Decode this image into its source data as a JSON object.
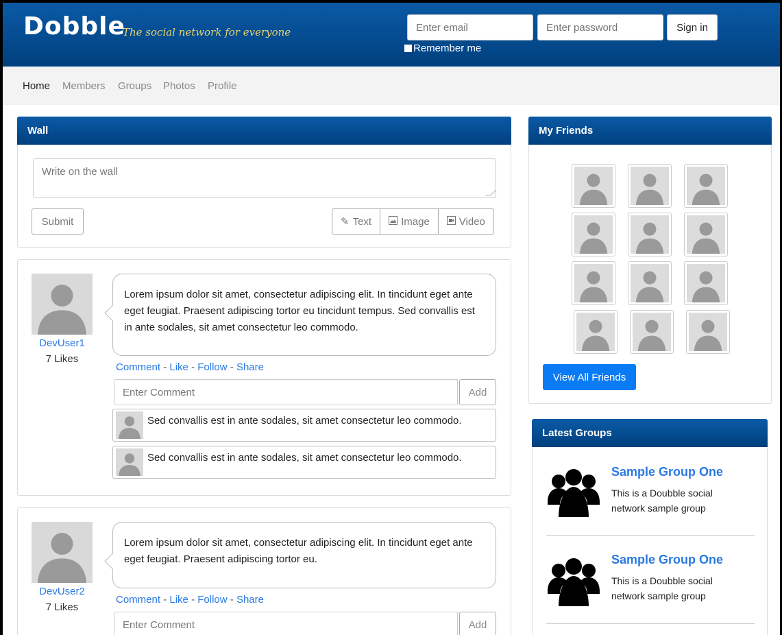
{
  "header": {
    "logo": "Dobble",
    "tagline": "The social network for everyone",
    "email_placeholder": "Enter email",
    "password_placeholder": "Enter password",
    "signin_label": "Sign in",
    "remember_label": "Remember me",
    "colors": {
      "bar": "#0b5aa6",
      "tagline": "#e7d36b"
    }
  },
  "nav": {
    "items": [
      {
        "label": "Home",
        "active": true
      },
      {
        "label": "Members"
      },
      {
        "label": "Groups"
      },
      {
        "label": "Photos"
      },
      {
        "label": "Profile"
      }
    ]
  },
  "wall": {
    "title": "Wall",
    "textarea_placeholder": "Write on the wall",
    "submit_label": "Submit",
    "post_types": [
      {
        "label": "Text",
        "icon": "pencil-icon"
      },
      {
        "label": "Image",
        "icon": "image-icon"
      },
      {
        "label": "Video",
        "icon": "video-icon"
      }
    ]
  },
  "posts": [
    {
      "user": "DevUser1",
      "likes": "7 Likes",
      "text": "Lorem ipsum dolor sit amet, consectetur adipiscing elit. In tincidunt eget ante eget feugiat. Praesent adipiscing tortor eu tincidunt tempus. Sed convallis est in ante sodales, sit amet consectetur leo commodo.",
      "actions": [
        "Comment",
        "Like",
        "Follow",
        "Share"
      ],
      "comment_placeholder": "Enter Comment",
      "add_label": "Add",
      "comments": [
        "Sed convallis est in ante sodales, sit amet consectetur leo commodo.",
        "Sed convallis est in ante sodales, sit amet consectetur leo commodo."
      ]
    },
    {
      "user": "DevUser2",
      "likes": "7 Likes",
      "text": "Lorem ipsum dolor sit amet, consectetur adipiscing elit. In tincidunt eget ante eget feugiat. Praesent adipiscing tortor eu.",
      "actions": [
        "Comment",
        "Like",
        "Follow",
        "Share"
      ],
      "comment_placeholder": "Enter Comment",
      "add_label": "Add"
    }
  ],
  "friends": {
    "title": "My Friends",
    "view_all_label": "View All Friends",
    "count": 12
  },
  "groups": {
    "title": "Latest Groups",
    "items": [
      {
        "name": "Sample Group One",
        "description": "This is a Doubble social network sample group",
        "icon": "group-icon"
      },
      {
        "name": "Sample Group One",
        "description": "This is a Doubble social network sample group",
        "icon": "group-icon"
      }
    ]
  }
}
